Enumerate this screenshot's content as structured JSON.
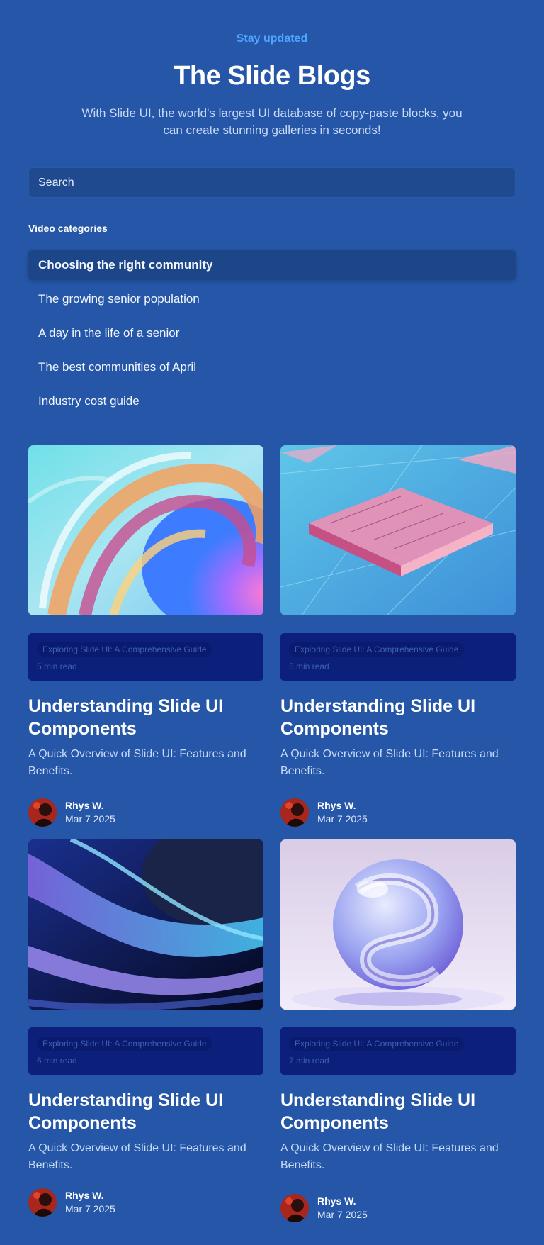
{
  "header": {
    "eyebrow": "Stay updated",
    "title": "The Slide Blogs",
    "subtitle": "With Slide UI, the world's largest UI database of copy-paste blocks, you can create stunning galleries in seconds!"
  },
  "search": {
    "placeholder": "Search"
  },
  "categories": {
    "heading": "Video categories",
    "items": [
      {
        "label": "Choosing the right community",
        "active": true
      },
      {
        "label": "The growing senior population",
        "active": false
      },
      {
        "label": "A day in the life of a senior",
        "active": false
      },
      {
        "label": "The best communities of April",
        "active": false
      },
      {
        "label": "Industry cost guide",
        "active": false
      }
    ]
  },
  "posts": [
    {
      "image": "abstract-glass-swirl-image",
      "tag": "Exploring Slide UI: A Comprehensive Guide",
      "read_time": "5 min read",
      "title": "Understanding Slide UI Components",
      "description": "A Quick Overview of Slide UI: Features and Benefits.",
      "author": "Rhys W.",
      "date": "Mar 7 2025"
    },
    {
      "image": "circuit-chip-image",
      "tag": "Exploring Slide UI: A Comprehensive Guide",
      "read_time": "5 min read",
      "title": "Understanding Slide UI Components",
      "description": "A Quick Overview of Slide UI: Features and Benefits.",
      "author": "Rhys W.",
      "date": "Mar 7 2025"
    },
    {
      "image": "blue-wave-ribbons-image",
      "tag": "Exploring Slide UI: A Comprehensive Guide",
      "read_time": "6 min read",
      "title": "Understanding Slide UI Components",
      "description": "A Quick Overview of Slide UI: Features and Benefits.",
      "author": "Rhys W.",
      "date": "Mar 7 2025"
    },
    {
      "image": "glass-sphere-image",
      "tag": "Exploring Slide UI: A Comprehensive Guide",
      "read_time": "7 min read",
      "title": "Understanding Slide UI Components",
      "description": "A Quick Overview of Slide UI: Features and Benefits.",
      "author": "Rhys W.",
      "date": "Mar 7 2025"
    }
  ],
  "colors": {
    "background": "#2556a8",
    "eyebrow": "#4da3ff",
    "meta_box": "#0c1f7a"
  }
}
